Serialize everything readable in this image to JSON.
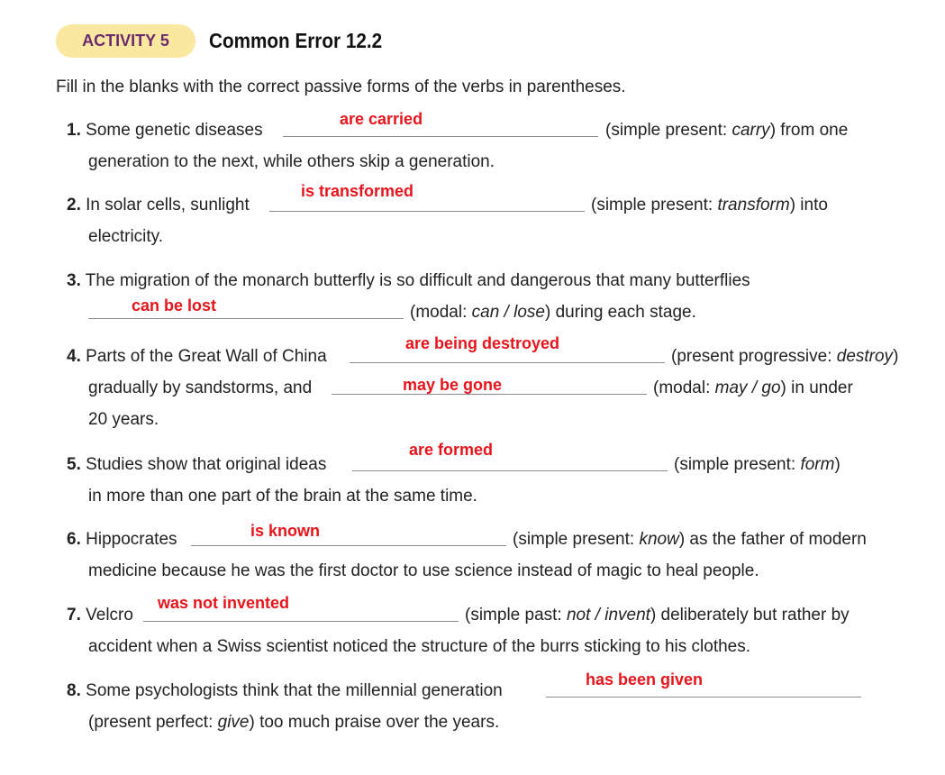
{
  "header": {
    "activity_label": "ACTIVITY 5",
    "title": "Common Error 12.2"
  },
  "instructions": "Fill in the blanks with the correct passive forms of the verbs in parentheses.",
  "items": [
    {
      "number": "1.",
      "before": "Some genetic diseases",
      "answer": "are carried",
      "after_1": "(simple present: ",
      "verb": "carry",
      "after_2": ") from one",
      "continuation": "generation to the next, while others skip a generation."
    },
    {
      "number": "2.",
      "before": "In solar cells, sunlight",
      "answer": "is transformed",
      "after_1": "(simple present: ",
      "verb": "transform",
      "after_2": ") into",
      "continuation": "electricity."
    },
    {
      "number": "3.",
      "before": "The migration of the monarch butterfly is so difficult and dangerous that many butterflies",
      "answer": "can be lost",
      "after_1": "(modal: ",
      "verb": "can / lose",
      "after_2": ") during each stage."
    },
    {
      "number": "4.",
      "before": "Parts of the Great Wall of China",
      "answer": "are being destroyed",
      "after_1": "(present progressive: ",
      "verb": "destroy",
      "after_2": ")",
      "line2_before": "gradually by sandstorms, and",
      "answer2": "may be gone",
      "line2_after_1": "(modal: ",
      "verb2": "may / go",
      "line2_after_2": ") in under",
      "continuation": "20 years."
    },
    {
      "number": "5.",
      "before": "Studies show that original ideas",
      "answer": "are formed",
      "after_1": "(simple present: ",
      "verb": "form",
      "after_2": ")",
      "continuation": "in more than one part of the brain at the same time."
    },
    {
      "number": "6.",
      "before": "Hippocrates",
      "answer": "is known",
      "after_1": "(simple present: ",
      "verb": "know",
      "after_2": ") as the father of modern",
      "continuation": "medicine because he was the first doctor to use science instead of magic to heal people."
    },
    {
      "number": "7.",
      "before": "Velcro",
      "answer": "was not invented",
      "after_1": "(simple past: ",
      "verb": "not / invent",
      "after_2": ") deliberately but rather by",
      "continuation": "accident when a Swiss scientist noticed the structure of the burrs sticking to his clothes."
    },
    {
      "number": "8.",
      "before": "Some psychologists think that the millennial generation",
      "answer": "has been given",
      "cont_1": "(present perfect: ",
      "verb": "give",
      "cont_2": ") too much praise over the years."
    }
  ]
}
